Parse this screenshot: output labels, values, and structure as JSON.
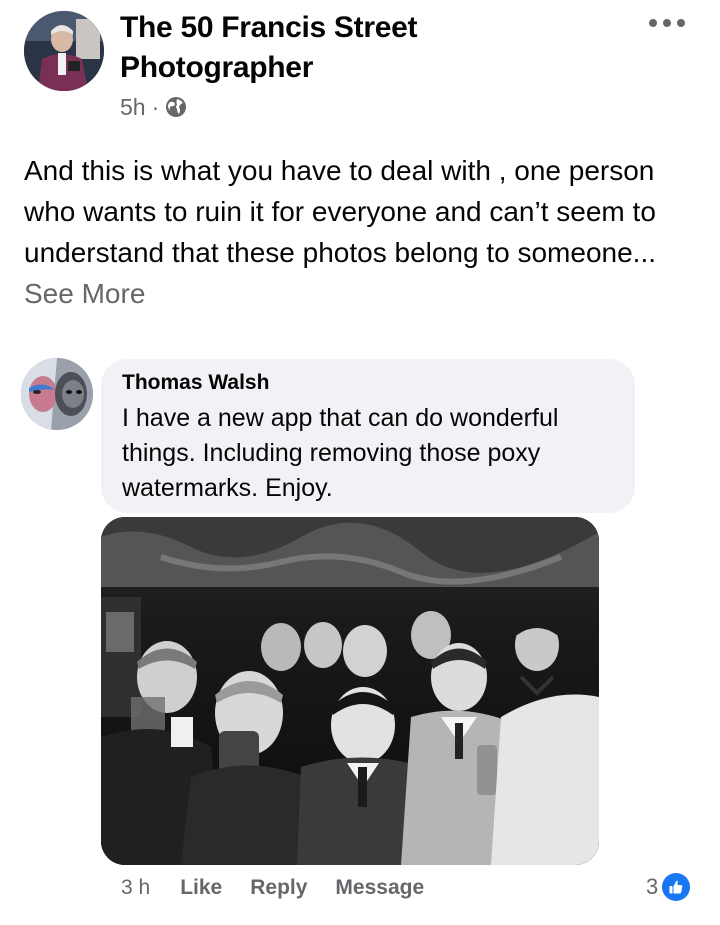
{
  "post": {
    "author": "The 50 Francis Street Photographer",
    "time": "5h",
    "separator": "·",
    "privacy_icon": "globe-icon",
    "text": "And this is what you have to deal with , one person who wants to ruin it for everyone and can’t seem to understand that these photos belong to someone...",
    "see_more": "See More",
    "more_icon": "more-options-icon"
  },
  "comment": {
    "author": "Thomas Walsh",
    "text": "I have a new app that can do wonderful things. Including removing those poxy watermarks. Enjoy.",
    "photo": "black-and-white-pub-photo",
    "time": "3 h",
    "actions": {
      "like": "Like",
      "reply": "Reply",
      "message": "Message"
    },
    "reaction_count": "3",
    "reaction_icon": "thumbs-up-icon",
    "colors": {
      "like_blue": "#1877f2",
      "bubble_gray": "#f0f2f5",
      "meta_gray": "#65676b"
    }
  }
}
